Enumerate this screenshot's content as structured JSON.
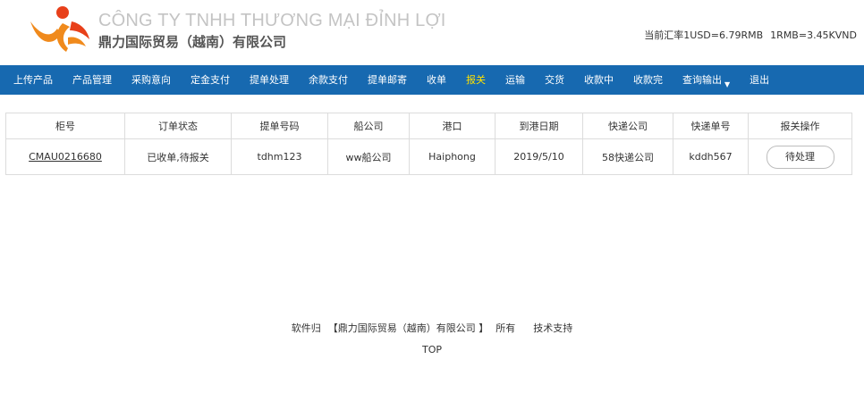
{
  "header": {
    "company_en": "CÔNG TY TNHH THƯƠNG MẠI ĐỈNH LỢI",
    "company_cn": "鼎力国际贸易（越南）有限公司",
    "rate_label": "当前汇率",
    "rate_usd": "1USD=6.79RMB",
    "rate_rmb": "1RMB=3.45KVND",
    "logo_colors": {
      "orange": "#f08a1c",
      "red": "#e8401a"
    }
  },
  "nav": {
    "items": [
      {
        "label": "上传产品"
      },
      {
        "label": "产品管理"
      },
      {
        "label": "采购意向"
      },
      {
        "label": "定金支付"
      },
      {
        "label": "提单处理"
      },
      {
        "label": "余款支付"
      },
      {
        "label": "提单邮寄"
      },
      {
        "label": "收单"
      },
      {
        "label": "报关",
        "active": true
      },
      {
        "label": "运输"
      },
      {
        "label": "交货"
      },
      {
        "label": "收款中"
      },
      {
        "label": "收款完"
      },
      {
        "label": "查询输出",
        "dropdown": true
      },
      {
        "label": "退出"
      }
    ],
    "bg_color": "#1769b0",
    "active_color": "#ffe100"
  },
  "table": {
    "headers": [
      "柜号",
      "订单状态",
      "提单号码",
      "船公司",
      "港口",
      "到港日期",
      "快递公司",
      "快递单号",
      "报关操作"
    ],
    "rows": [
      {
        "container_no": "CMAU0216680",
        "status": "已收单,待报关",
        "bl_no": "tdhm123",
        "shipping_co": "ww船公司",
        "port": "Haiphong",
        "arrival_date": "2019/5/10",
        "courier": "58快递公司",
        "courier_no": "kddh567",
        "action": "待处理"
      }
    ]
  },
  "footer": {
    "owner_prefix": "软件归",
    "owner_name": "【鼎力国际贸易（越南）有限公司 】",
    "owner_suffix": "所有",
    "support": "技术支持",
    "top": "TOP"
  }
}
